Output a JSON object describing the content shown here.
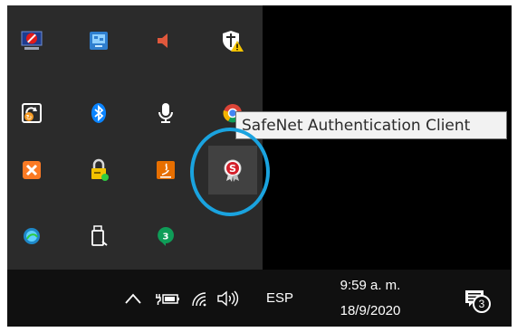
{
  "tray_overflow": {
    "icons": [
      {
        "name": "remote-desktop-blocked-icon"
      },
      {
        "name": "network-app-icon"
      },
      {
        "name": "speaker-muted-icon"
      },
      {
        "name": "windows-security-warning-icon"
      },
      {
        "name": "sync-app-icon"
      },
      {
        "name": "bluetooth-icon"
      },
      {
        "name": "microphone-icon"
      },
      {
        "name": "chrome-icon"
      },
      {
        "name": "xampp-icon"
      },
      {
        "name": "vpn-lock-icon"
      },
      {
        "name": "java-icon"
      },
      {
        "name": "safenet-authentication-client-icon"
      },
      {
        "name": "app-globe-icon"
      },
      {
        "name": "usb-safely-remove-icon"
      },
      {
        "name": "hangouts-badge-icon",
        "badge": "3"
      }
    ],
    "tooltip": "SafeNet Authentication Client"
  },
  "taskbar": {
    "language": "ESP",
    "time": "9:59 a. m.",
    "date": "18/9/2020",
    "notification_count": "3"
  },
  "colors": {
    "highlight_ring": "#1aa3df",
    "tray_bg": "#2b2b2b",
    "taskbar_bg": "#101010"
  }
}
